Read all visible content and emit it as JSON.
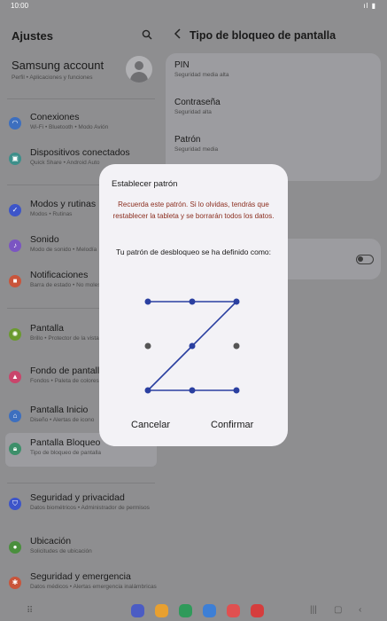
{
  "status": {
    "time": "10:00",
    "signal": "ıl ▮"
  },
  "left": {
    "title": "Ajustes",
    "account": {
      "name": "Samsung account",
      "sub": "Perfil • Aplicaciones y funciones"
    },
    "items": [
      {
        "label": "Conexiones",
        "sub": "Wi-Fi • Bluetooth • Modo Avión",
        "icon": "wifi-icon",
        "color": "#3d6fbf"
      },
      {
        "label": "Dispositivos conectados",
        "sub": "Quick Share • Android Auto",
        "icon": "devices-icon",
        "color": "#3d8f8a"
      },
      {
        "label": "Modos y rutinas",
        "sub": "Modos • Rutinas",
        "icon": "check-circle-icon",
        "color": "#3d55c9"
      },
      {
        "label": "Sonido",
        "sub": "Modo de sonido • Melodía",
        "icon": "volume-icon",
        "color": "#7b55c2"
      },
      {
        "label": "Notificaciones",
        "sub": "Barra de estado • No molestar",
        "icon": "bell-icon",
        "color": "#c9553b"
      },
      {
        "label": "Pantalla",
        "sub": "Brillo • Protector de la vista • Barra de navegación",
        "icon": "sun-icon",
        "color": "#6b9a2f"
      },
      {
        "label": "Fondo de pantalla y estilo",
        "sub": "Fondos • Paleta de colores",
        "icon": "image-icon",
        "color": "#c9456b"
      },
      {
        "label": "Pantalla Inicio",
        "sub": "Diseño • Alertas de icono",
        "icon": "home-icon",
        "color": "#3d6fbf"
      },
      {
        "label": "Pantalla Bloqueo",
        "sub": "Tipo de bloqueo de pantalla",
        "icon": "lock-icon",
        "color": "#3d8f6a"
      },
      {
        "label": "Seguridad y privacidad",
        "sub": "Datos biométricos • Administrador de permisos",
        "icon": "shield-icon",
        "color": "#3d55c9"
      },
      {
        "label": "Ubicación",
        "sub": "Solicitudes de ubicación",
        "icon": "location-icon",
        "color": "#4a8f3d"
      },
      {
        "label": "Seguridad y emergencia",
        "sub": "Datos médicos • Alertas emergencia inalámbricas",
        "icon": "emergency-icon",
        "color": "#c9553b"
      }
    ]
  },
  "right": {
    "title": "Tipo de bloqueo de pantalla",
    "options": [
      {
        "label": "PIN",
        "sub": "Seguridad media alta"
      },
      {
        "label": "Contraseña",
        "sub": "Seguridad alta"
      },
      {
        "label": "Patrón",
        "sub": "Seguridad media"
      }
    ]
  },
  "dialog": {
    "title": "Establecer patrón",
    "warning": "Recuerda este patrón. Si lo olvidas, tendrás que restablecer la tableta y se borrarán todos los datos.",
    "info": "Tu patrón de desbloqueo se ha definido como:",
    "pattern_sequence": [
      1,
      2,
      3,
      5,
      7,
      8,
      9
    ],
    "cancel": "Cancelar",
    "confirm": "Confirmar",
    "pattern_color": "#2a3fa0"
  },
  "dock": [
    {
      "icon": "samsung-internet-icon",
      "color": "#4b5cc4"
    },
    {
      "icon": "my-files-icon",
      "color": "#e8a030"
    },
    {
      "icon": "phone-icon",
      "color": "#2f9a5a"
    },
    {
      "icon": "messages-icon",
      "color": "#3d7fd6"
    },
    {
      "icon": "galaxy-store-icon",
      "color": "#e05050"
    },
    {
      "icon": "camera-icon",
      "color": "#d63d3d"
    }
  ]
}
